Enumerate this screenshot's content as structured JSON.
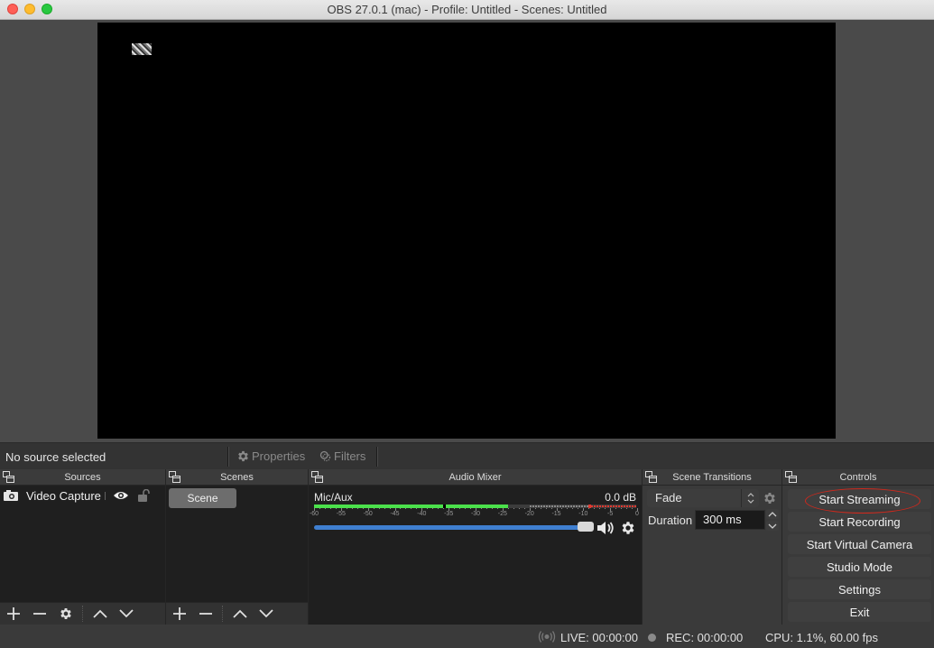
{
  "window": {
    "title": "OBS 27.0.1 (mac) - Profile: Untitled - Scenes: Untitled"
  },
  "context_bar": {
    "selection_label": "No source selected",
    "properties_label": "Properties",
    "filters_label": "Filters"
  },
  "docks": {
    "sources": {
      "title": "Sources",
      "items": [
        {
          "name": "Video Capture I",
          "icon": "camera-icon",
          "visible": true,
          "locked": false
        }
      ]
    },
    "scenes": {
      "title": "Scenes",
      "items": [
        {
          "name": "Scene",
          "selected": true
        }
      ]
    },
    "audio_mixer": {
      "title": "Audio Mixer",
      "channels": [
        {
          "name": "Mic/Aux",
          "level_db": "0.0 dB",
          "meter_peak_db": -24,
          "meter_max_marker_db": -9,
          "volume_fraction": 1.0,
          "scale_labels": [
            "-60",
            "-55",
            "-50",
            "-45",
            "-40",
            "-35",
            "-30",
            "-25",
            "-20",
            "-15",
            "-10",
            "-5",
            "0"
          ]
        }
      ]
    },
    "scene_transitions": {
      "title": "Scene Transitions",
      "transition": "Fade",
      "duration_label": "Duration",
      "duration_value": "300 ms"
    },
    "controls": {
      "title": "Controls",
      "buttons": [
        "Start Streaming",
        "Start Recording",
        "Start Virtual Camera",
        "Studio Mode",
        "Settings",
        "Exit"
      ]
    }
  },
  "status_bar": {
    "live": "LIVE: 00:00:00",
    "rec": "REC: 00:00:00",
    "cpu": "CPU: 1.1%, 60.00 fps"
  },
  "colors": {
    "meter_green": "#4be04b",
    "meter_red": "#e0382f",
    "volume_blue": "#3f7fd0",
    "highlight_red": "#d0281c"
  }
}
